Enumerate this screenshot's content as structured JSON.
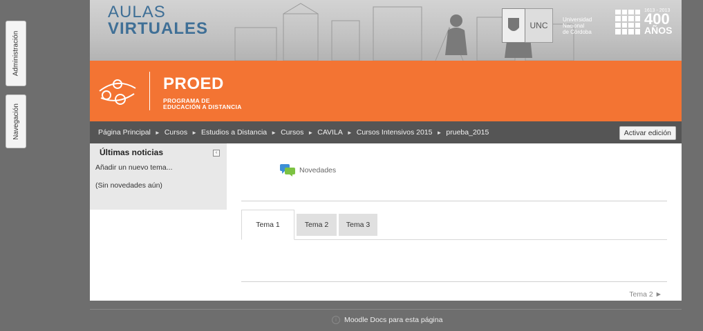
{
  "dock": {
    "admin": "Administración",
    "nav": "Navegación"
  },
  "banner": {
    "title_line1": "AULAS",
    "title_line2": "VIRTUALES",
    "unc_label": "UNC",
    "unc_name_1": "Universidad",
    "unc_name_2": "Nacional",
    "unc_name_3": "de Córdoba",
    "anos_years": "1613 - 2013",
    "anos_number": "400",
    "anos_word": "AÑOS"
  },
  "proed": {
    "title": "PROED",
    "subtitle_1": "PROGRAMA DE",
    "subtitle_2": "EDUCACIÓN A DISTANCIA"
  },
  "breadcrumb": {
    "items": [
      "Página Principal",
      "Cursos",
      "Estudios a Distancia",
      "Cursos",
      "CAVILA",
      "Cursos Intensivos 2015",
      "prueba_2015"
    ],
    "separator": "►"
  },
  "toolbar": {
    "edit_label": "Activar edición"
  },
  "news_block": {
    "heading": "Últimas noticias",
    "add_link": "Añadir un nuevo tema...",
    "empty_text": "(Sin novedades aún)"
  },
  "forum": {
    "label": "Novedades"
  },
  "tabs": [
    {
      "label": "Tema 1",
      "active": true
    },
    {
      "label": "Tema 2",
      "active": false
    },
    {
      "label": "Tema 3",
      "active": false
    }
  ],
  "pager": {
    "next_label": "Tema 2 ►"
  },
  "footer": {
    "docs_label": "Moodle Docs para esta página"
  },
  "colors": {
    "brand_orange": "#f37433",
    "link_blue": "#3f6f96",
    "bar_dark": "#555555"
  }
}
